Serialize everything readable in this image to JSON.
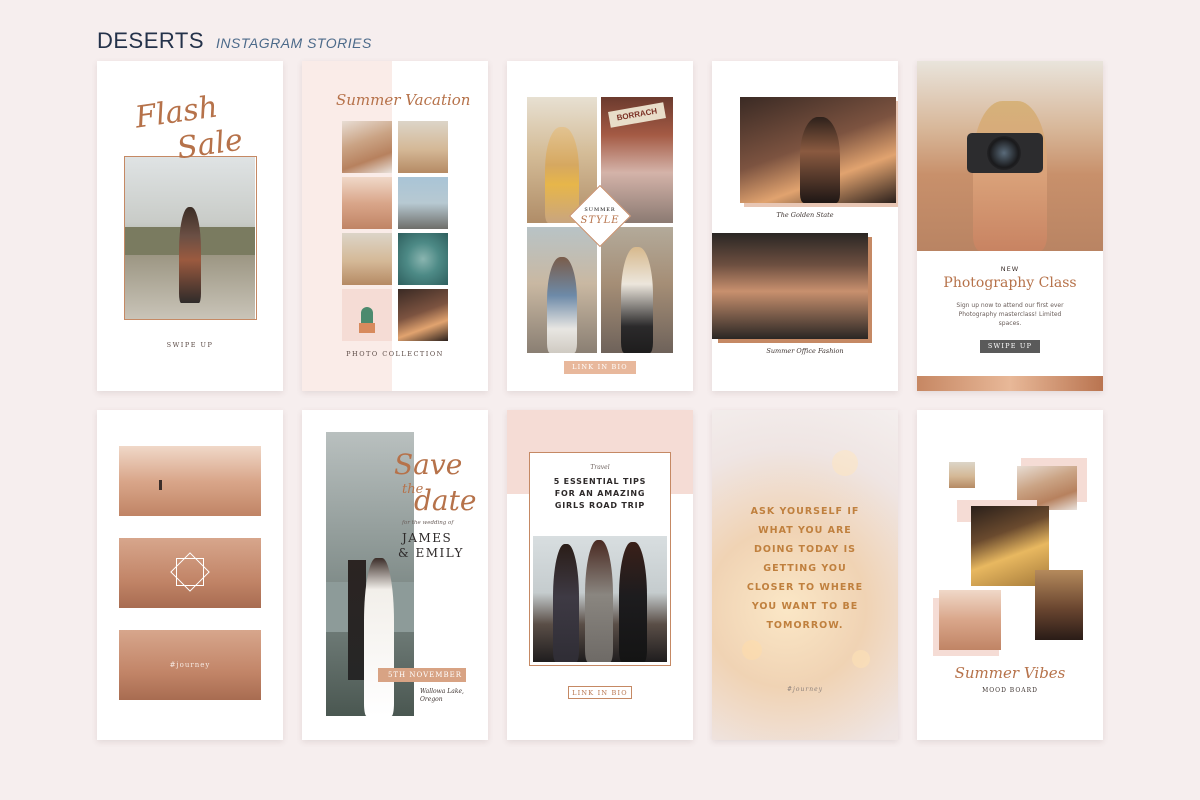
{
  "header": {
    "brand": "DESERTS",
    "subtitle": "INSTAGRAM STORIES"
  },
  "cards": {
    "flash": {
      "script_line1": "Flash",
      "script_line2": "Sale",
      "caption": "SWIPE UP"
    },
    "vacation": {
      "script": "Summer Vacation",
      "caption": "PHOTO COLLECTION"
    },
    "style": {
      "overlay_top": "SUMMER",
      "overlay_main": "STYLE",
      "sign": "BORRACH",
      "button": "LINK IN BIO"
    },
    "golden": {
      "caption1": "The Golden State",
      "caption2": "Summer Office Fashion"
    },
    "photo_class": {
      "eyebrow": "NEW",
      "title": "Photography Class",
      "body": "Sign up now to attend our first ever Photography masterclass! Limited spaces.",
      "button": "SWIPE UP"
    },
    "journey": {
      "hashtag": "#journey"
    },
    "save_date": {
      "line1": "Save",
      "line2": "the",
      "line3": "date",
      "small": "for the wedding of",
      "names1": "JAMES",
      "names2": "& EMILY",
      "date": "5TH NOVEMBER",
      "location1": "Wallowa Lake,",
      "location2": "Oregon"
    },
    "tips": {
      "eyebrow": "Travel",
      "title1": "5 ESSENTIAL TIPS",
      "title2": "FOR AN AMAZING",
      "title3": "GIRLS ROAD TRIP",
      "button": "LINK IN BIO"
    },
    "quote": {
      "lines": [
        "ASK YOURSELF IF",
        "WHAT YOU ARE",
        "DOING TODAY IS",
        "GETTING YOU",
        "CLOSER TO WHERE",
        "YOU WANT TO BE",
        "TOMORROW."
      ],
      "hashtag": "#journey"
    },
    "mood": {
      "script": "Summer Vibes",
      "caption": "MOOD BOARD"
    }
  },
  "colors": {
    "background": "#f6eeee",
    "copper": "#b6724a",
    "navy": "#24324a",
    "slate_button": "#5a5a5a",
    "blush": "#f5dcd5"
  }
}
